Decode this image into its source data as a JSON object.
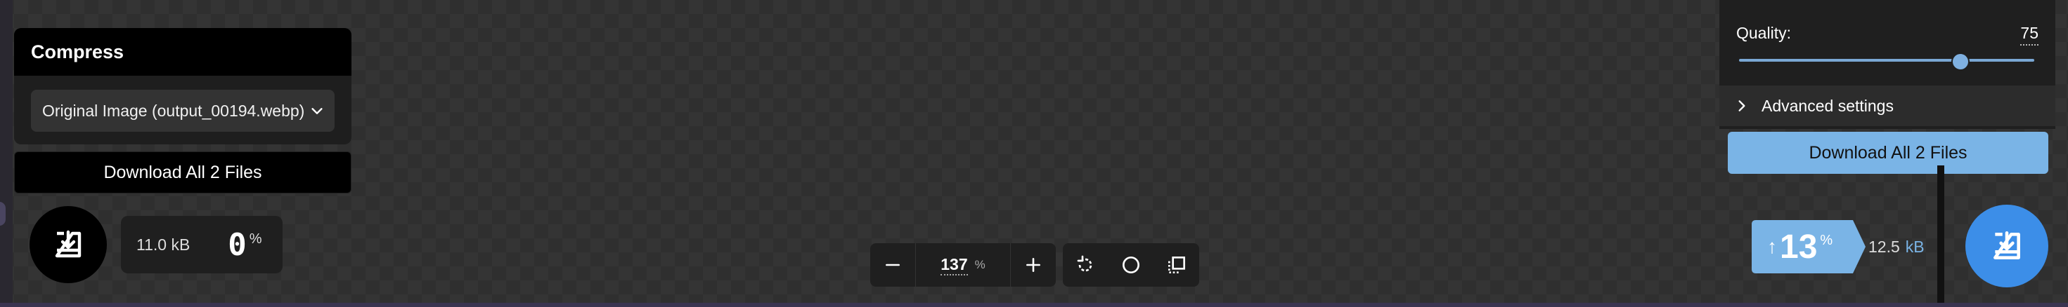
{
  "left_panel": {
    "title": "Compress",
    "source_select": "Original Image (output_00194.webp)",
    "download_all_label": "Download All 2 Files",
    "file_size": "11.0 kB",
    "percent": "0",
    "percent_sign": "%"
  },
  "toolbar": {
    "zoom_value": "137",
    "zoom_unit": "%"
  },
  "right_panel": {
    "quality_label": "Quality:",
    "quality_value": "75",
    "advanced_settings_label": "Advanced settings",
    "download_all_label": "Download All 2 Files",
    "change_arrow": "↑",
    "change_percent": "13",
    "percent_sign": "%",
    "file_size_value": "12.5",
    "file_size_unit": "kB"
  },
  "slider": {
    "min": 0,
    "max": 100,
    "value": 75
  },
  "colors": {
    "accent_blue": "#7ab4e6",
    "download_blue": "#3c8ee8",
    "panel_dark": "#1f1f1f"
  },
  "icons": {
    "download": "download-tray-icon",
    "zoom_out": "minus-icon",
    "zoom_in": "plus-icon",
    "rotate": "rotate-icon",
    "circle": "circle-icon",
    "crop": "crop-frame-icon",
    "chevron_down": "chevron-down-icon",
    "chevron_right": "chevron-right-icon"
  }
}
